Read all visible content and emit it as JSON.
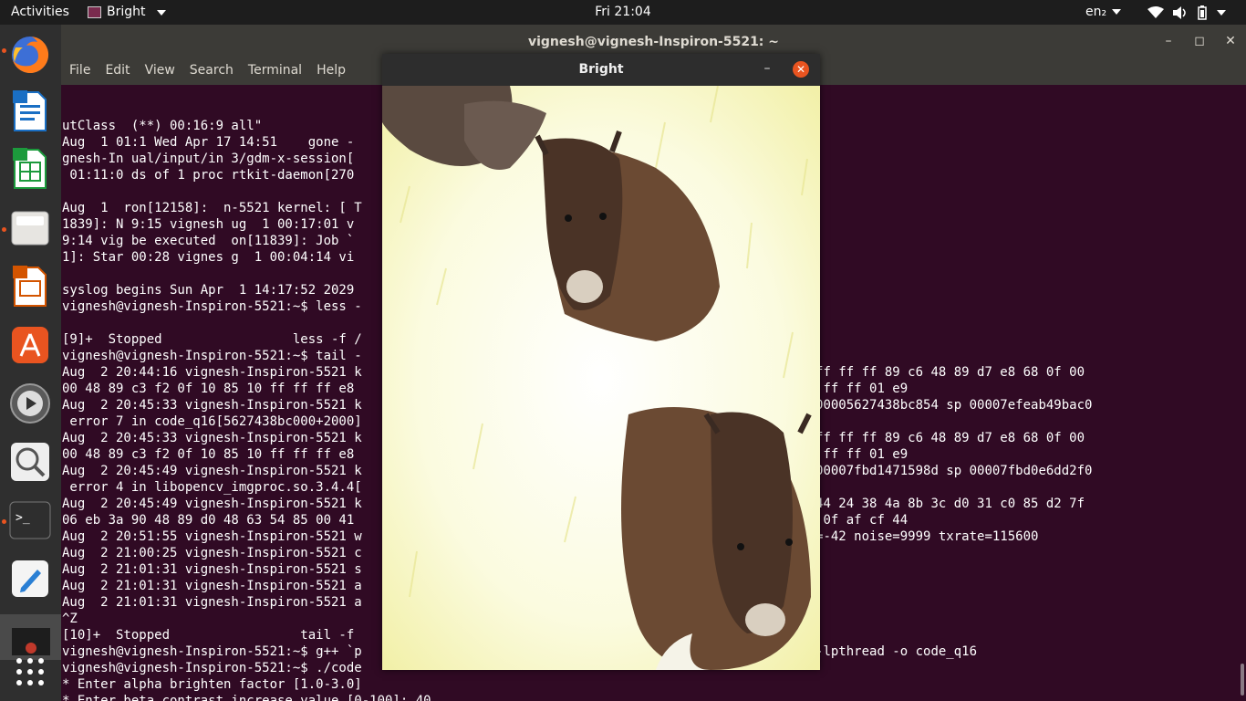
{
  "topbar": {
    "activities": "Activities",
    "app_name": "Bright",
    "clock": "Fri 21:04",
    "lang": "en₂"
  },
  "dock": {
    "icons": [
      "firefox-icon",
      "writer-icon",
      "calc-icon",
      "files-icon",
      "impress-icon",
      "software-center-icon",
      "videos-icon",
      "screenshot-icon",
      "terminal-icon",
      "text-editor-icon",
      "window-preview-icon",
      "app-grid-icon"
    ]
  },
  "terminal": {
    "title": "vignesh@vignesh-Inspiron-5521: ~",
    "menu": [
      "File",
      "Edit",
      "View",
      "Search",
      "Terminal",
      "Help"
    ],
    "lines": [
      "utClass  (**) 00:16:9 all\"",
      "Aug  1 01:1 Wed Apr 17 14:51    gone -",
      "gnesh-In ual/input/in 3/gdm-x-session[",
      " 01:11:0 ds of 1 proc rtkit-daemon[270",
      "",
      "Aug  1  ron[12158]:  n-5521 kernel: [ T",
      "1839]: N 9:15 vignesh ug  1 00:17:01 v",
      "9:14 vig be executed  on[11839]: Job `",
      "1]: Star 00:28 vignes g  1 00:04:14 vi",
      "",
      "syslog begins Sun Apr  1 14:17:52 2029",
      "vignesh@vignesh-Inspiron-5521:~$ less -",
      "",
      "[9]+  Stopped                 less -f /",
      "vignesh@vignesh-Inspiron-5521:~$ tail -",
      "Aug  2 20:44:16 vignesh-Inspiron-5521 k                                             9 c2 8b 85 34 ff ff ff 89 c6 48 89 d7 e8 68 0f 00",
      "00 48 89 c3 f2 0f 10 85 10 ff ff ff e8                                              ff 83 85 30 ff ff ff 01 e9",
      "Aug  2 20:45:33 vignesh-Inspiron-5521 k                                             feabd88000 ip 00005627438bc854 sp 00007efeab49bac0",
      " error 7 in code_q16[5627438bc000+2000]",
      "Aug  2 20:45:33 vignesh-Inspiron-5521 k                                             9 c2 8b 85 34 ff ff ff 89 c6 48 89 d7 e8 68 0f 00",
      "00 48 89 c3 f2 0f 10 85 10 ff ff ff e8                                              ff 83 85 30 ff ff ff 01 e9",
      "Aug  2 20:45:49 vignesh-Inspiron-5521 k                                             bd696b44e0 ip 00007fbd1471598d sp 00007fbd0e6dd2f0",
      " error 4 in libopencv_imgproc.so.3.4.4[",
      "Aug  2 20:45:49 vignesh-Inspiron-5521 k                                             b 34 d0 48 8b 44 24 38 4a 8b 3c d0 31 c0 85 d2 7f",
      "06 eb 3a 90 48 89 d0 48 63 54 85 00 41                                              0f 4c 83 02 41 0f af cf 44",
      "Aug  2 20:51:55 vignesh-Inspiron-5521 w                                             above=1 signal=-42 noise=9999 txrate=115600",
      "Aug  2 21:00:25 vignesh-Inspiron-5521 c",
      "Aug  2 21:01:31 vignesh-Inspiron-5521 s",
      "Aug  2 21:01:31 vignesh-Inspiron-5521 a",
      "Aug  2 21:01:31 vignesh-Inspiron-5521 a",
      "^Z",
      "[10]+  Stopped                 tail -f",
      "vignesh@vignesh-Inspiron-5521:~$ g++ `p                                             -libs opencv` -lpthread -o code_q16",
      "vignesh@vignesh-Inspiron-5521:~$ ./code",
      "* Enter alpha brighten factor [1.0-3.0]",
      "* Enter beta contrast increase value [0-100]: 40"
    ]
  },
  "bright_window": {
    "title": "Bright",
    "image_desc_colors": {
      "background": "#fbfbe0",
      "animal": "#6b4a33"
    }
  }
}
